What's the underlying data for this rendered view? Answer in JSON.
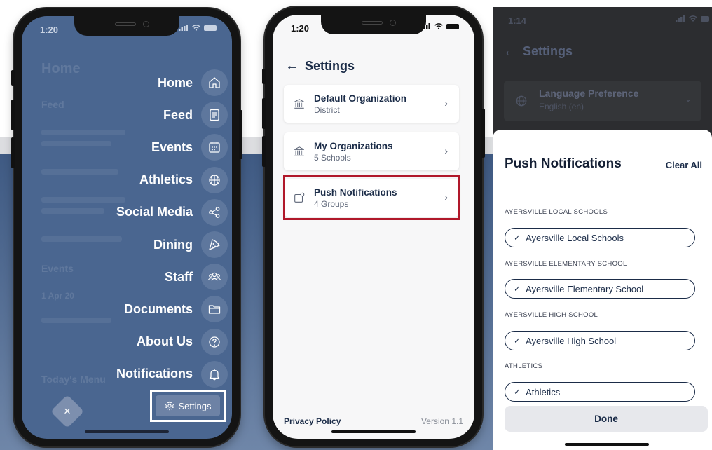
{
  "colors": {
    "menu_bg": "#4a6690",
    "navy": "#1b2c48",
    "highlight_red": "#b0182a"
  },
  "phone1": {
    "time": "1:20",
    "faded_background": {
      "title": "Home",
      "section_feed": "Feed",
      "section_events": "Events",
      "event_date": "1 Apr 20",
      "section_today": "Today's Menu"
    },
    "menu": [
      {
        "label": "Home",
        "icon": "home-icon"
      },
      {
        "label": "Feed",
        "icon": "feed-icon"
      },
      {
        "label": "Events",
        "icon": "calendar-icon"
      },
      {
        "label": "Athletics",
        "icon": "basketball-icon"
      },
      {
        "label": "Social Media",
        "icon": "share-icon"
      },
      {
        "label": "Dining",
        "icon": "pizza-icon"
      },
      {
        "label": "Staff",
        "icon": "people-icon"
      },
      {
        "label": "Documents",
        "icon": "folder-icon"
      },
      {
        "label": "About Us",
        "icon": "question-icon"
      },
      {
        "label": "Notifications",
        "icon": "bell-icon"
      }
    ],
    "close_symbol": "×",
    "settings_label": "Settings"
  },
  "phone2": {
    "time": "1:20",
    "title": "Settings",
    "cards": [
      {
        "title": "Default Organization",
        "subtitle": "District",
        "icon": "building-icon"
      },
      {
        "title": "My Organizations",
        "subtitle": "5 Schools",
        "icon": "building-icon"
      },
      {
        "title": "Push Notifications",
        "subtitle": "4 Groups",
        "icon": "notification-icon"
      }
    ],
    "privacy_policy": "Privacy Policy",
    "version": "Version 1.1"
  },
  "phone3": {
    "time": "1:14",
    "bg_title": "Settings",
    "bg_card": {
      "title": "Language Preference",
      "subtitle": "English (en)",
      "icon": "globe-icon"
    },
    "sheet_title": "Push Notifications",
    "clear_all": "Clear All",
    "groups": [
      {
        "label": "AYERSVILLE LOCAL SCHOOLS",
        "chip": "Ayersville Local Schools"
      },
      {
        "label": "AYERSVILLE ELEMENTARY SCHOOL",
        "chip": "Ayersville Elementary School"
      },
      {
        "label": "AYERSVILLE HIGH SCHOOL",
        "chip": "Ayersville High School"
      },
      {
        "label": "ATHLETICS",
        "chip": "Athletics"
      }
    ],
    "done": "Done"
  }
}
